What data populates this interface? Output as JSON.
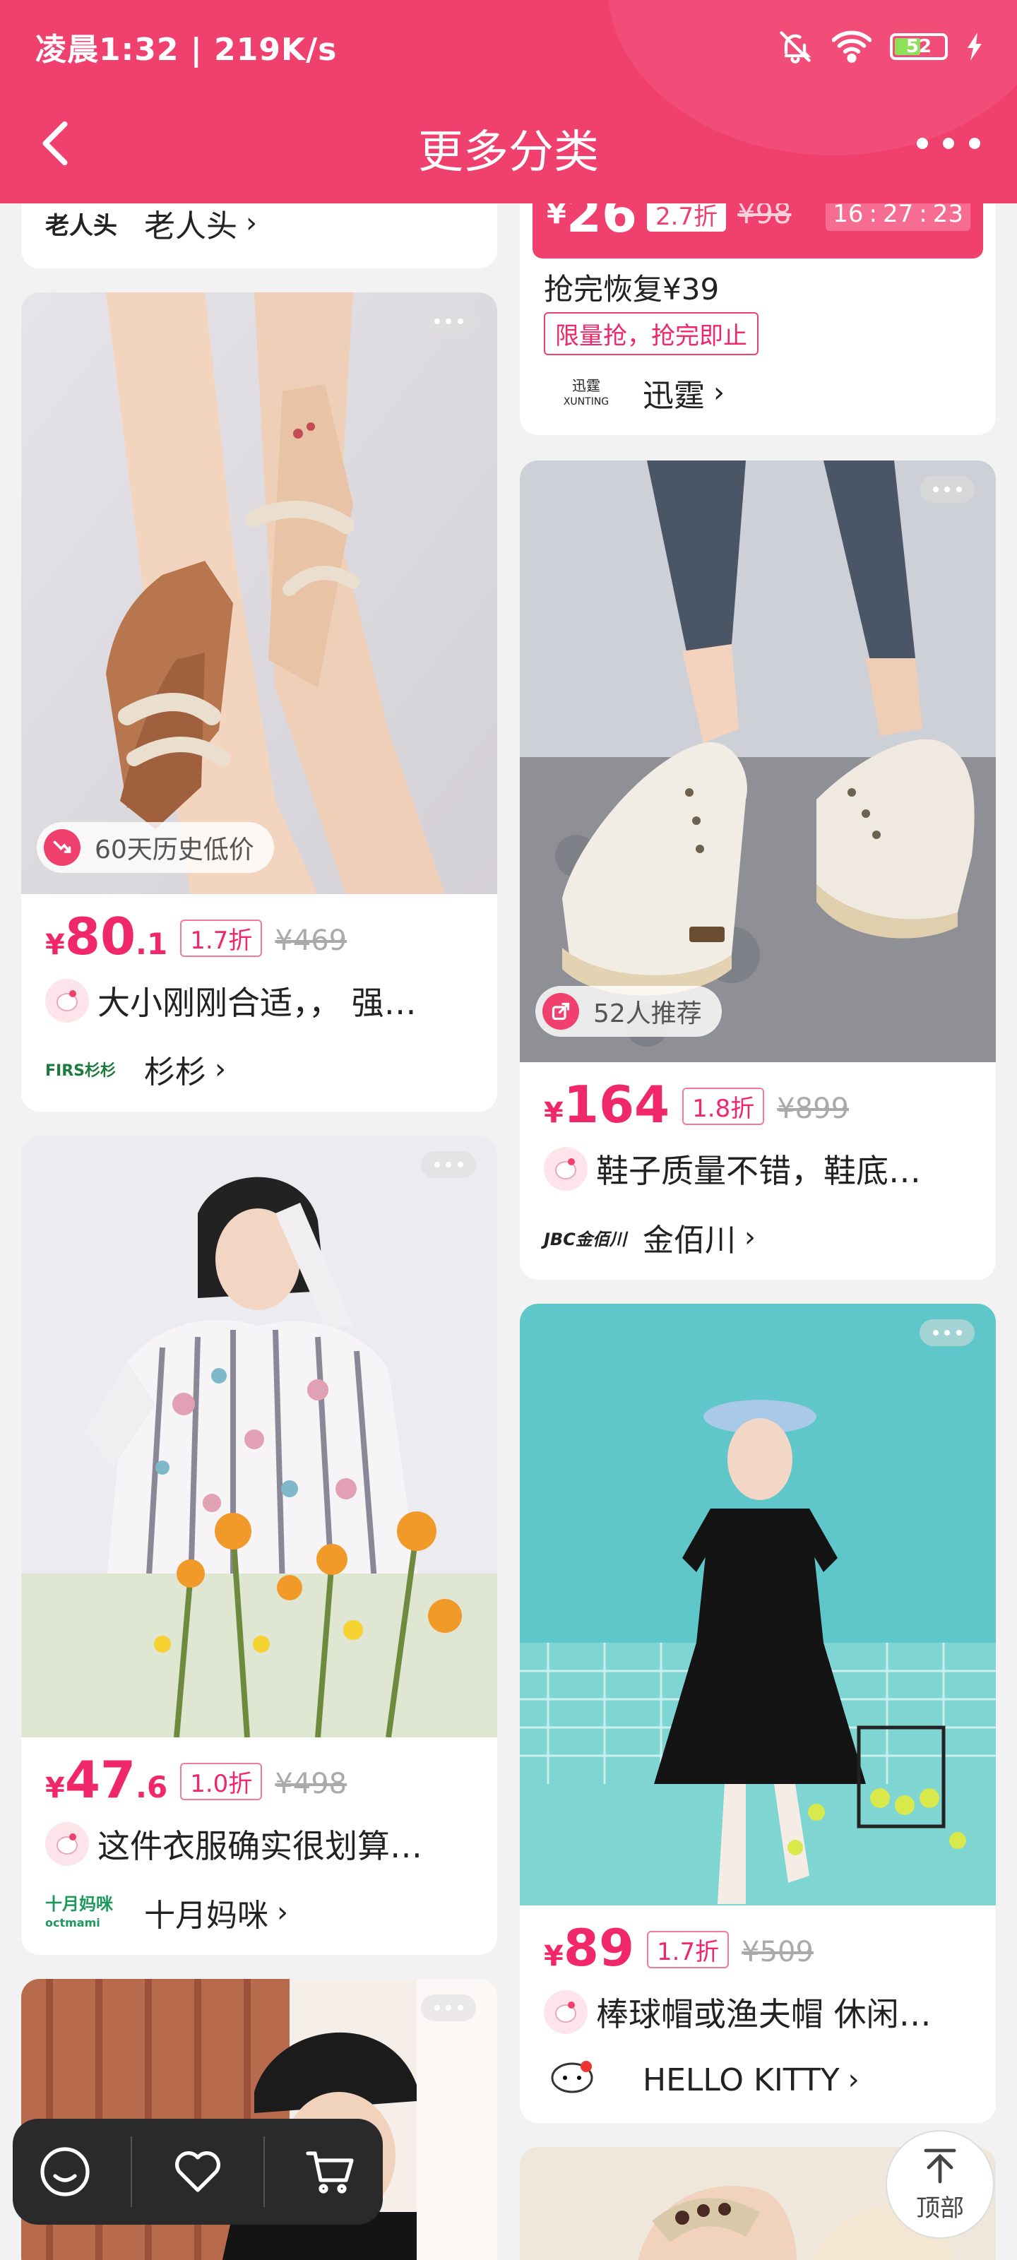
{
  "status_bar": {
    "time_speed": "凌晨1:32 | 219K/s",
    "battery": "52"
  },
  "header": {
    "title": "更多分类"
  },
  "cards": {
    "top_left": {
      "brand_logo": "老人头",
      "brand_name": "老人头"
    },
    "top_right": {
      "currency": "¥",
      "price": "26",
      "discount": "2.7折",
      "original": "¥98",
      "countdown": [
        "16",
        "27",
        "23"
      ],
      "restock_text": "抢完恢复¥39",
      "limit_tag": "限量抢，抢完即止",
      "brand_logo": "迅霆",
      "brand_logo_sub": "XUNTING",
      "brand_name": "迅霆"
    },
    "sandals": {
      "badge": "60天历史低价",
      "currency": "¥",
      "price_int": "80",
      "price_dec": ".1",
      "discount": "1.7折",
      "original": "¥469",
      "review": "大小刚刚合适，， 强…",
      "brand_logo": "FIRS杉杉",
      "brand_name": "杉杉"
    },
    "sneakers": {
      "badge": "52人推荐",
      "currency": "¥",
      "price_int": "164",
      "price_dec": "",
      "discount": "1.8折",
      "original": "¥899",
      "review": "鞋子质量不错，鞋底…",
      "brand_logo": "JBC金佰川",
      "brand_name": "金佰川"
    },
    "blouse": {
      "currency": "¥",
      "price_int": "47",
      "price_dec": ".6",
      "discount": "1.0折",
      "original": "¥498",
      "review": "这件衣服确实很划算…",
      "brand_logo": "十月妈咪",
      "brand_logo_sub": "octmami",
      "brand_name": "十月妈咪"
    },
    "dress": {
      "currency": "¥",
      "price_int": "89",
      "price_dec": "",
      "discount": "1.7折",
      "original": "¥509",
      "review": "棒球帽或渔夫帽 休闲…",
      "brand_logo": "HELLO KITTY",
      "brand_name": "HELLO KITTY"
    }
  },
  "top_button": {
    "label": "顶部"
  },
  "colors": {
    "accent": "#f0406e",
    "price": "#f0286a"
  }
}
